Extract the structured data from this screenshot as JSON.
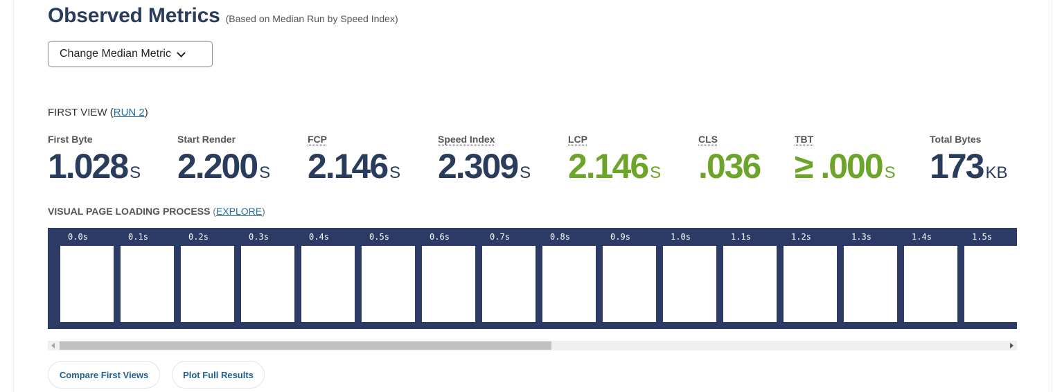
{
  "header": {
    "title": "Observed Metrics",
    "subtitle": "(Based on Median Run by Speed Index)"
  },
  "median_dropdown": {
    "label": "Change Median Metric",
    "icon": "chevron-down-icon"
  },
  "first_view": {
    "prefix": "FIRST VIEW (",
    "run_link": "RUN 2",
    "suffix": ")"
  },
  "metrics": [
    {
      "label": "First Byte",
      "value": "1.028",
      "unit": "S"
    },
    {
      "label": "Start Render",
      "value": "2.200",
      "unit": "S"
    },
    {
      "label": "FCP",
      "value": "2.146",
      "unit": "S"
    },
    {
      "label": "Speed Index",
      "value": "2.309",
      "unit": "S"
    },
    {
      "label": "LCP",
      "value": "2.146",
      "unit": "S"
    },
    {
      "label": "CLS",
      "value": ".036",
      "unit": ""
    },
    {
      "label": "TBT",
      "value": "≥ .000",
      "unit": "S"
    },
    {
      "label": "Total Bytes",
      "value": "173",
      "unit": "KB"
    }
  ],
  "colors": {
    "good": "#6ca52a",
    "neutral": "#2a3c5c",
    "filmstrip_bg": "#2b3b66",
    "link": "#1f6fa6"
  },
  "visual_progress": {
    "label": "VISUAL PAGE LOADING PROCESS",
    "open_paren": " (",
    "explore_link": "EXPLORE",
    "close_paren": ")"
  },
  "filmstrip": {
    "frames": [
      "0.0s",
      "0.1s",
      "0.2s",
      "0.3s",
      "0.4s",
      "0.5s",
      "0.6s",
      "0.7s",
      "0.8s",
      "0.9s",
      "1.0s",
      "1.1s",
      "1.2s",
      "1.3s",
      "1.4s",
      "1.5s"
    ],
    "scroll_fraction": 0.52
  },
  "buttons": {
    "compare": "Compare First Views",
    "plot": "Plot Full Results"
  }
}
